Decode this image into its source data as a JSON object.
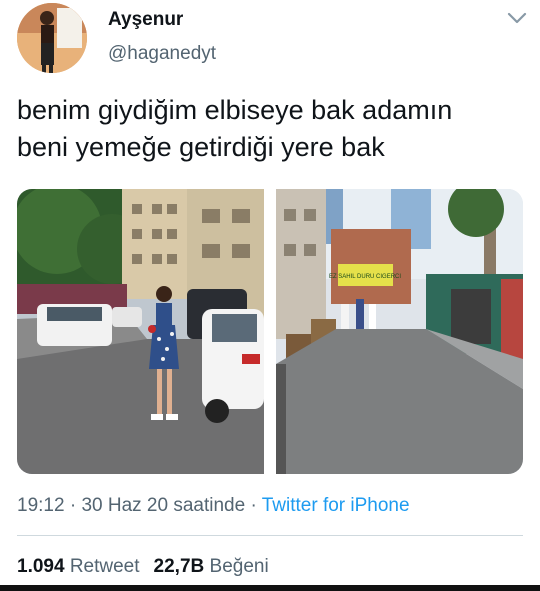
{
  "user": {
    "display_name": "Ayşenur",
    "handle": "@haganedyt"
  },
  "tweet": {
    "line1": "benim giydiğim elbiseye bak adamın",
    "line2": "beni yemeğe getirdiği yere bak",
    "photo_sign_text": "EZ SAHIL DURU CIGERCI"
  },
  "meta": {
    "time": "19:12",
    "dot1": " · ",
    "date": "30 Haz 20 saatinde",
    "dot2": " · ",
    "source": "Twitter for iPhone"
  },
  "stats": {
    "retweets": "1.094",
    "retweets_label": "Retweet",
    "likes": "22,7B",
    "likes_label": "Beğeni"
  },
  "icons": {
    "more": "chevron-down-icon"
  },
  "colors": {
    "link": "#1d9bf0",
    "secondary": "#536471"
  }
}
